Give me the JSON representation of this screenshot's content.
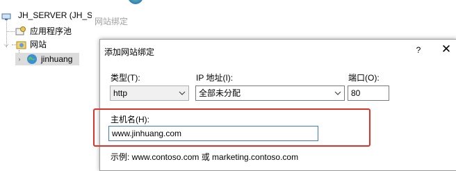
{
  "tree": {
    "server": "JH_SERVER (JH_SE",
    "app_pools": "应用程序池",
    "sites": "网站",
    "site_selected": "jinhuang"
  },
  "background_dialog": {
    "title": "网站绑定"
  },
  "dialog": {
    "title": "添加网站绑定",
    "help": "?",
    "close": "✕",
    "type_label": "类型(T):",
    "type_value": "http",
    "ip_label": "IP 地址(I):",
    "ip_value": "全部未分配",
    "port_label": "端口(O):",
    "port_value": "80",
    "host_label": "主机名(H):",
    "host_value": "www.jinhuang.com",
    "example": "示例: www.contoso.com 或 marketing.contoso.com"
  },
  "colors": {
    "highlight": "#e0302a",
    "focus_border": "#3a7bd5",
    "disabled_text": "#a0a0a0"
  },
  "icons": [
    "server-icon",
    "app-pool-icon",
    "sites-folder-icon",
    "globe-icon",
    "chevron-down-icon",
    "help-icon",
    "close-icon"
  ]
}
